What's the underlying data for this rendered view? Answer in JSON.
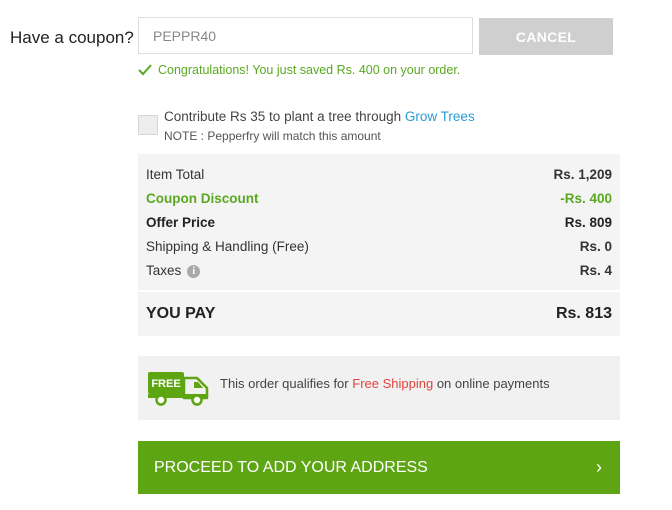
{
  "coupon": {
    "label": "Have a coupon?",
    "value": "PEPPR40",
    "cancel_label": "CANCEL",
    "success_message": "Congratulations! You just saved Rs. 400 on your order."
  },
  "tree": {
    "text": "Contribute Rs 35 to plant a tree through",
    "link": "Grow Trees",
    "note": "NOTE : Pepperfry will match this amount"
  },
  "summary": {
    "item_total_label": "Item Total",
    "item_total_value": "Rs. 1,209",
    "discount_label": "Coupon Discount",
    "discount_value": "-Rs. 400",
    "offer_label": "Offer Price",
    "offer_value": "Rs. 809",
    "shipping_label": "Shipping & Handling (Free)",
    "shipping_value": "Rs. 0",
    "taxes_label": "Taxes",
    "taxes_value": "Rs. 4",
    "pay_label": "YOU PAY",
    "pay_value": "Rs. 813"
  },
  "shipping_notice": {
    "badge": "FREE",
    "text_before": "This order qualifies for",
    "highlight": "Free Shipping",
    "text_after": "on online payments"
  },
  "proceed": {
    "label": "PROCEED TO ADD YOUR ADDRESS",
    "chevron": "›"
  },
  "colors": {
    "green": "#5da512",
    "success": "#5aa821",
    "link": "#2a9bd8",
    "red": "#e2443c"
  },
  "icons": [
    "check-icon",
    "info-icon",
    "free-truck-icon",
    "chevron-right-icon"
  ]
}
